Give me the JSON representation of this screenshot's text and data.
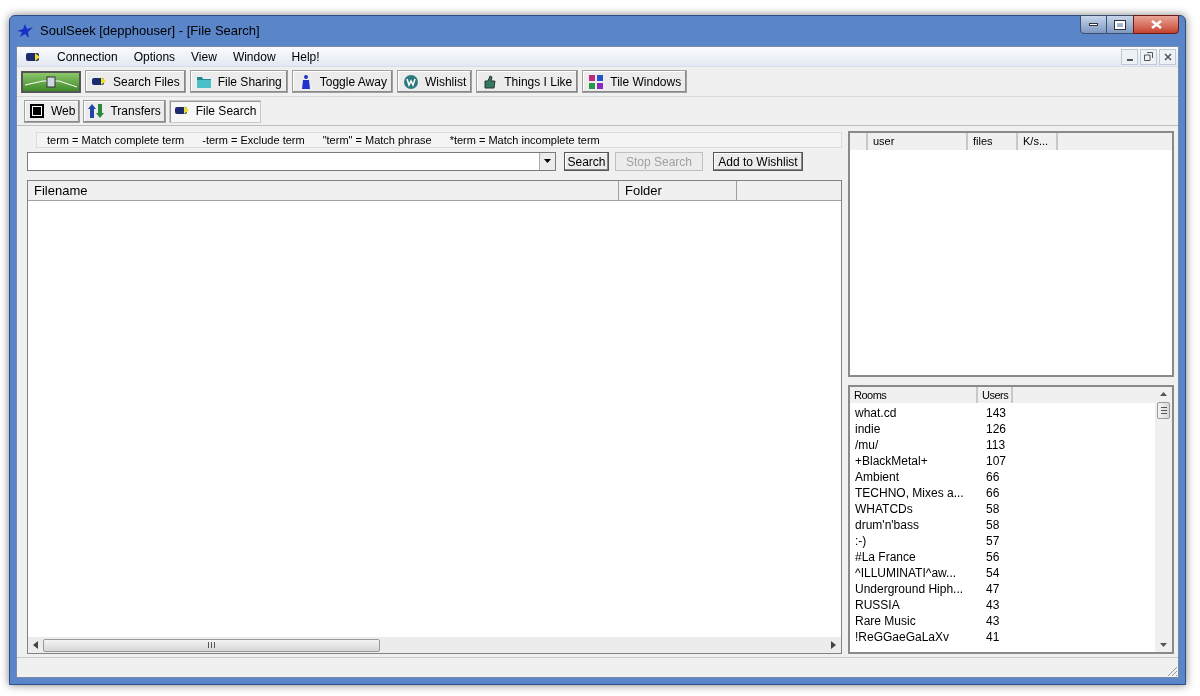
{
  "window": {
    "title": "SoulSeek [depphouser] - [File Search]"
  },
  "menu": [
    "Connection",
    "Options",
    "View",
    "Window",
    "Help!"
  ],
  "toolbar": [
    "Search Files",
    "File Sharing",
    "Toggle Away",
    "Wishlist",
    "Things I Like",
    "Tile Windows"
  ],
  "tabs": [
    {
      "label": "Web",
      "selected": false
    },
    {
      "label": "Transfers",
      "selected": false
    },
    {
      "label": "File Search",
      "selected": true
    }
  ],
  "search": {
    "hints": [
      "term = Match complete term",
      "-term = Exclude term",
      "\"term\" = Match phrase",
      "*term = Match incomplete term"
    ],
    "buttons": [
      {
        "label": "Search",
        "disabled": false
      },
      {
        "label": "Stop Search",
        "disabled": true
      },
      {
        "label": "Add to Wishlist",
        "disabled": false
      }
    ]
  },
  "results": {
    "columns": [
      "Filename",
      "Folder"
    ]
  },
  "users": {
    "columns": [
      "user",
      "files",
      "K/s..."
    ]
  },
  "rooms": {
    "columns": [
      "Rooms",
      "Users"
    ],
    "rows": [
      {
        "name": "what.cd",
        "users": "143"
      },
      {
        "name": "indie",
        "users": "126"
      },
      {
        "name": "/mu/",
        "users": "113"
      },
      {
        "name": "+BlackMetal+",
        "users": "107"
      },
      {
        "name": "Ambient",
        "users": "66"
      },
      {
        "name": "TECHNO, Mixes a...",
        "users": "66"
      },
      {
        "name": "WHATCDs",
        "users": "58"
      },
      {
        "name": "drum'n'bass",
        "users": "58"
      },
      {
        "name": ":-)",
        "users": "57"
      },
      {
        "name": "#La France",
        "users": "56"
      },
      {
        "name": "^ILLUMINATI^aw...",
        "users": "54"
      },
      {
        "name": "Underground Hiph...",
        "users": "47"
      },
      {
        "name": "RUSSIA",
        "users": "43"
      },
      {
        "name": "Rare Music",
        "users": "43"
      },
      {
        "name": "!ReGGaeGaLaXv",
        "users": "41"
      }
    ]
  }
}
